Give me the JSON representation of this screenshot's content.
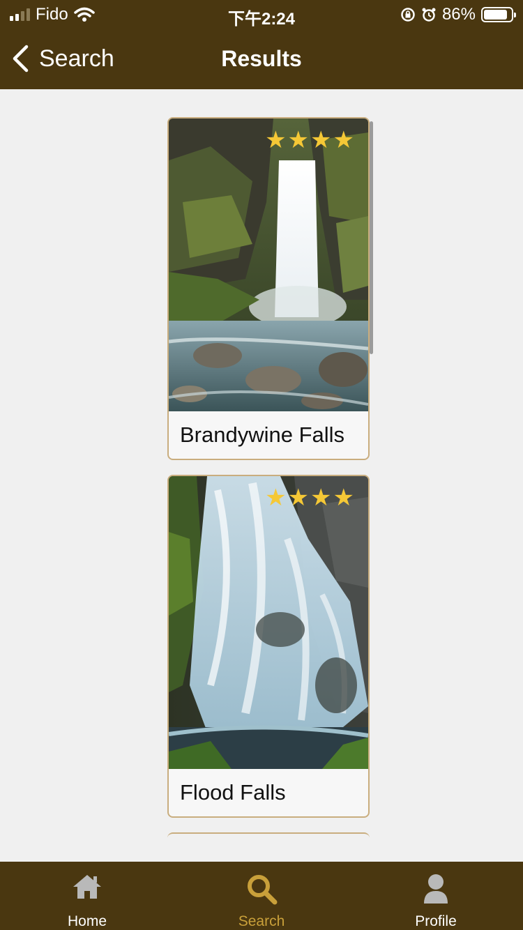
{
  "status_bar": {
    "carrier": "Fido",
    "time": "下午2:24",
    "battery": "86%",
    "battery_level": 0.86
  },
  "nav": {
    "back_label": "Search",
    "title": "Results"
  },
  "results": [
    {
      "name": "Brandywine Falls",
      "rating": 4,
      "image": "waterfall-photo-tall"
    },
    {
      "name": "Flood Falls",
      "rating": 4,
      "image": "waterfall-photo-cascade"
    }
  ],
  "tabbar": {
    "items": [
      {
        "label": "Home",
        "icon": "home-icon",
        "active": false
      },
      {
        "label": "Search",
        "icon": "search-icon",
        "active": true
      },
      {
        "label": "Profile",
        "icon": "profile-icon",
        "active": false
      }
    ]
  },
  "colors": {
    "header_bg": "#4a3710",
    "card_border": "#c9ad7e",
    "star": "#f5c836",
    "active_tab": "#c9a03a"
  }
}
